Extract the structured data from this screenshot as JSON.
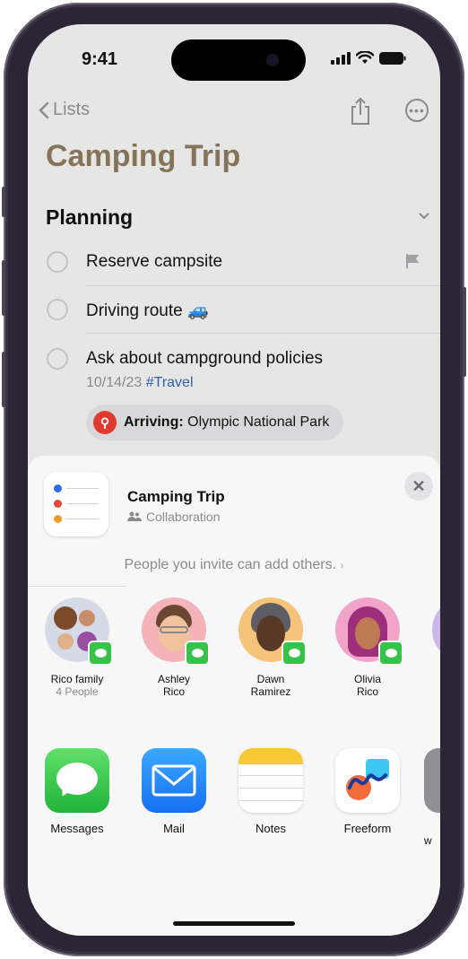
{
  "status": {
    "time": "9:41"
  },
  "nav": {
    "back_label": "Lists"
  },
  "list": {
    "title": "Camping Trip",
    "section": "Planning",
    "items": [
      {
        "text": "Reserve campsite"
      },
      {
        "text": "Driving route 🚙"
      },
      {
        "text": "Ask about campground policies",
        "date": "10/14/23",
        "tag": "#Travel"
      }
    ],
    "location": {
      "prefix": "Arriving:",
      "place": "Olympic National Park"
    }
  },
  "sheet": {
    "title": "Camping Trip",
    "subtitle": "Collaboration",
    "invite_note": "People you invite can add others.",
    "contacts": [
      {
        "name": "Rico family",
        "sub": "4 People"
      },
      {
        "name": "Ashley",
        "sub": "Rico"
      },
      {
        "name": "Dawn",
        "sub": "Ramirez"
      },
      {
        "name": "Olivia",
        "sub": "Rico"
      }
    ],
    "apps": [
      {
        "label": "Messages"
      },
      {
        "label": "Mail"
      },
      {
        "label": "Notes"
      },
      {
        "label": "Freeform"
      },
      {
        "label": "w"
      }
    ]
  },
  "colors": {
    "title_accent": "#85745a",
    "tag_blue": "#2f5fa6",
    "messages_green": "#37c24a",
    "pin_red": "#e03a2e"
  }
}
